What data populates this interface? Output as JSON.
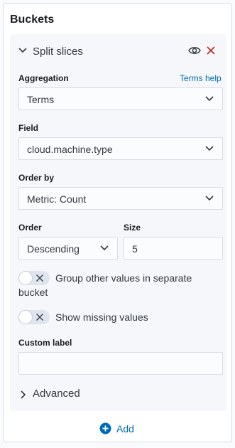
{
  "section_title": "Buckets",
  "bucket": {
    "header_label": "Split slices",
    "aggregation": {
      "label": "Aggregation",
      "help_link": "Terms help",
      "value": "Terms"
    },
    "field": {
      "label": "Field",
      "value": "cloud.machine.type"
    },
    "order_by": {
      "label": "Order by",
      "value": "Metric: Count"
    },
    "order": {
      "label": "Order",
      "value": "Descending"
    },
    "size": {
      "label": "Size",
      "value": "5"
    },
    "group_other": {
      "label": "Group other values in separate bucket",
      "enabled": false
    },
    "show_missing": {
      "label": "Show missing values",
      "enabled": false
    },
    "custom_label": {
      "label": "Custom label",
      "value": "",
      "placeholder": ""
    },
    "advanced_label": "Advanced"
  },
  "add_button": {
    "label": "Add"
  },
  "icons": {
    "collapse": "chevron-down-icon",
    "visibility": "eye-icon",
    "remove": "close-icon",
    "advanced": "chevron-right-icon",
    "add": "plus-circle-icon"
  },
  "colors": {
    "link": "#006bb4",
    "remove": "#bd271e",
    "panel_bg": "#f5f7fa"
  }
}
